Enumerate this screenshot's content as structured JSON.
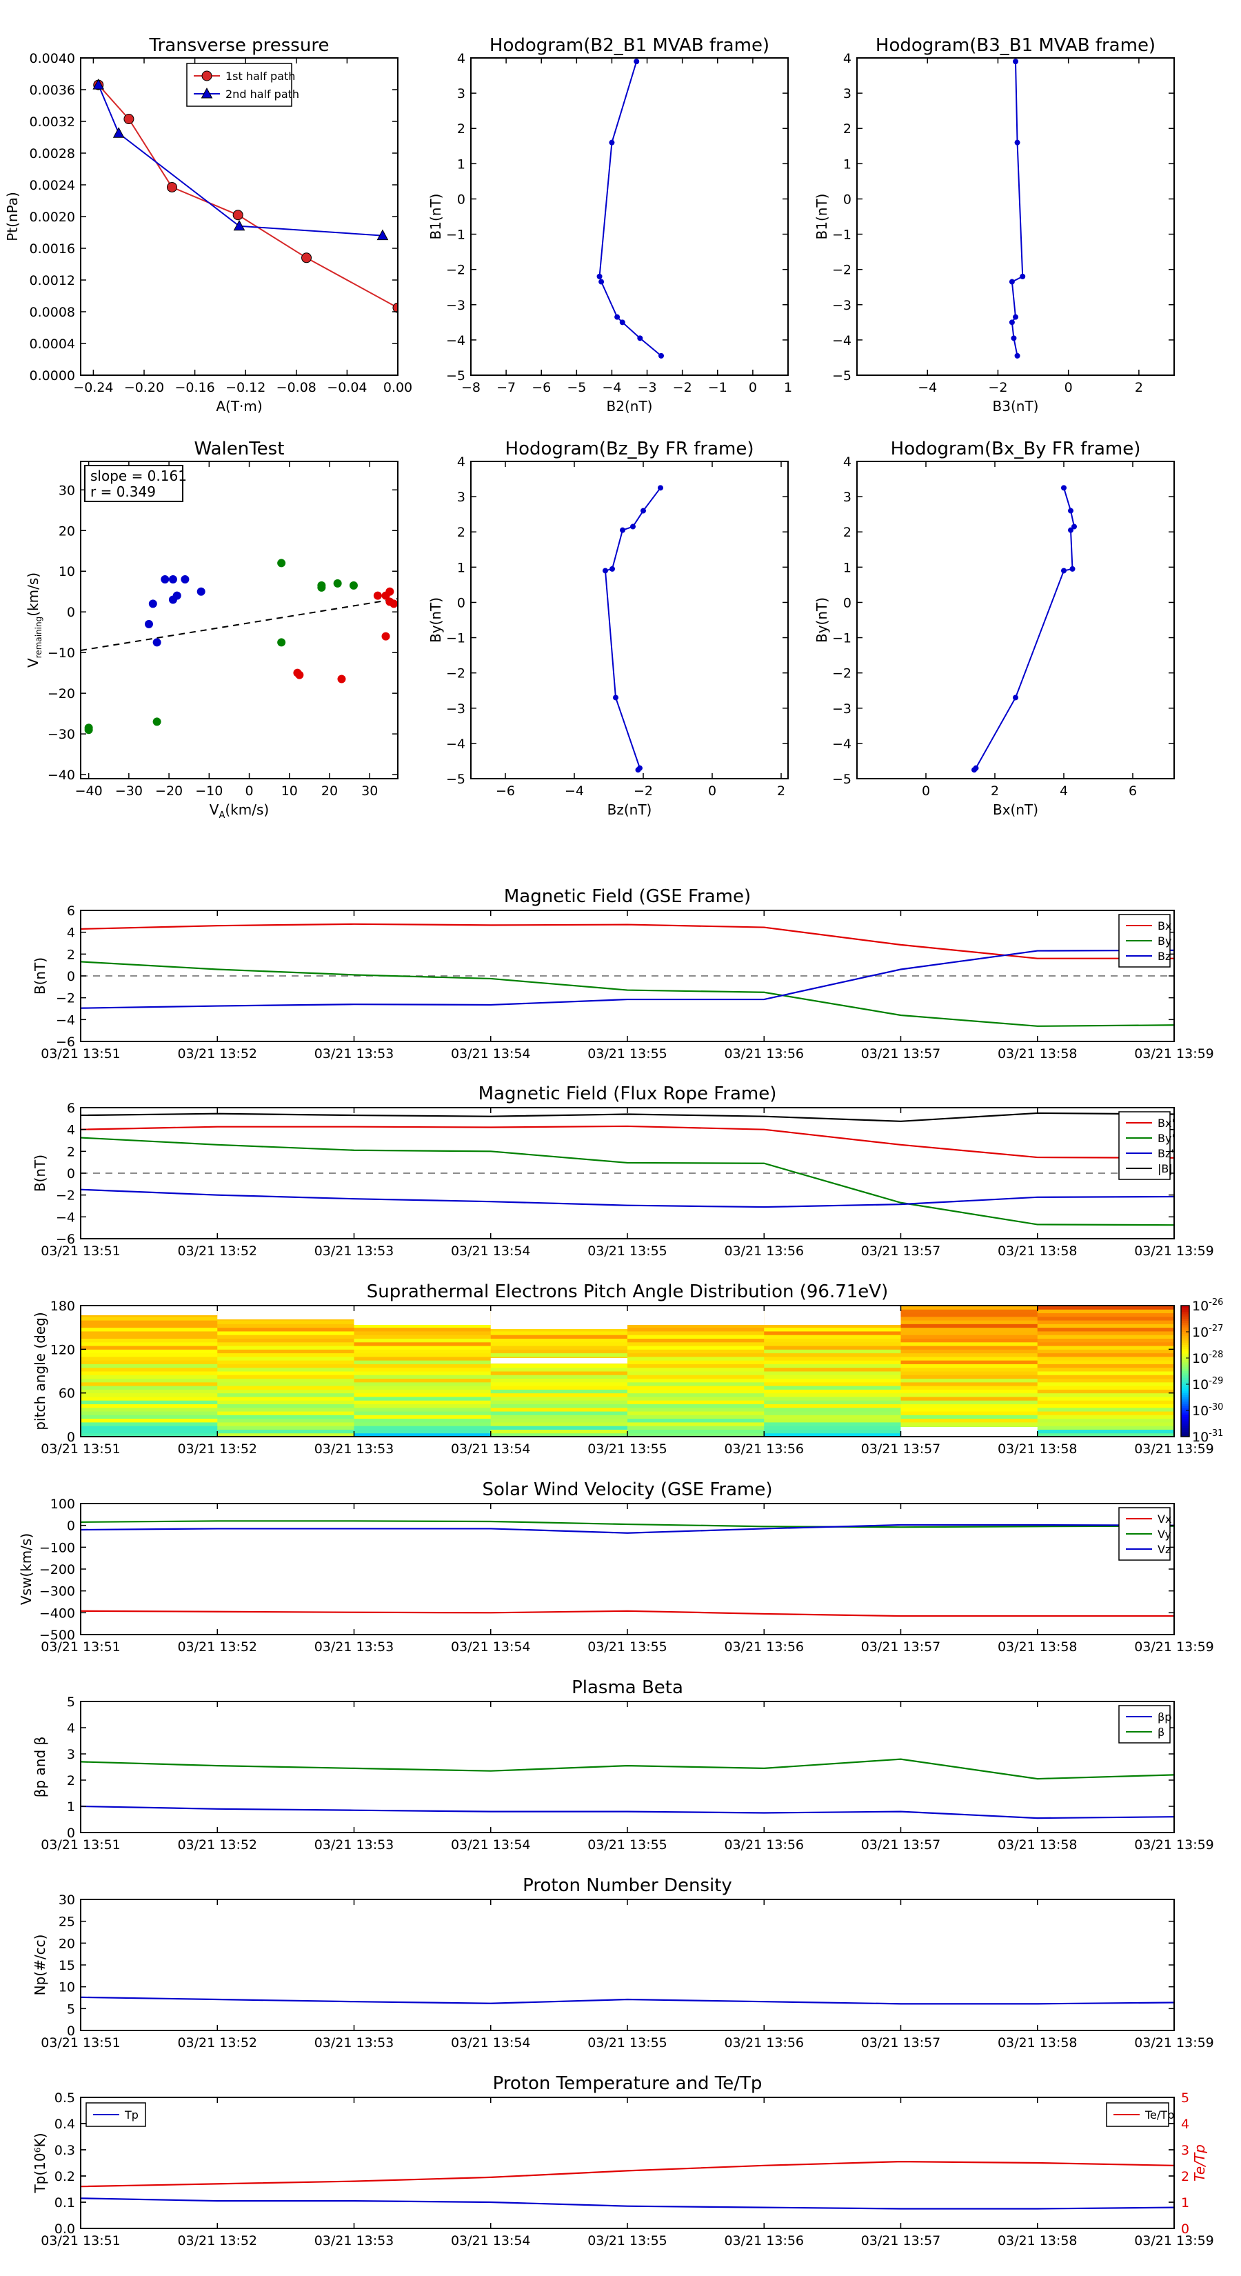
{
  "chart_data": [
    {
      "id": "p1",
      "type": "line",
      "title": "Transverse pressure",
      "xlabel": "A(T·m)",
      "ylabel": "Pt(nPa)",
      "xlim": [
        -0.25,
        0.0
      ],
      "ylim": [
        0.0,
        0.004
      ],
      "xticks": [
        -0.24,
        -0.2,
        -0.16,
        -0.12,
        -0.08,
        -0.04,
        0.0
      ],
      "xticklabels": [
        "−0.24",
        "−0.20",
        "−0.16",
        "−0.12",
        "−0.08",
        "−0.04",
        "0.00"
      ],
      "yticks": [
        0.0,
        0.0004,
        0.0008,
        0.0012,
        0.0016,
        0.002,
        0.0024,
        0.0028,
        0.0032,
        0.0036,
        0.004
      ],
      "yticklabels": [
        "0.0000",
        "0.0004",
        "0.0008",
        "0.0012",
        "0.0016",
        "0.0020",
        "0.0024",
        "0.0028",
        "0.0032",
        "0.0036",
        "0.0040"
      ],
      "legend": "top-center",
      "series": [
        {
          "name": "1st half path",
          "color": "#d62728",
          "marker": "circle",
          "x": [
            -0.236,
            -0.212,
            -0.178,
            -0.126,
            -0.072,
            0.0
          ],
          "y": [
            0.00366,
            0.00323,
            0.00237,
            0.00202,
            0.00148,
            0.00085
          ]
        },
        {
          "name": "2nd half path",
          "color": "#0000cc",
          "marker": "triangle",
          "x": [
            -0.236,
            -0.22,
            -0.125,
            -0.012
          ],
          "y": [
            0.00366,
            0.00305,
            0.00188,
            0.00176
          ]
        }
      ]
    },
    {
      "id": "p2",
      "type": "line",
      "title": "Hodogram(B2_B1 MVAB frame)",
      "xlabel": "B2(nT)",
      "ylabel": "B1(nT)",
      "xlim": [
        -8,
        1
      ],
      "ylim": [
        -5,
        4
      ],
      "xticks": [
        -8,
        -7,
        -6,
        -5,
        -4,
        -3,
        -2,
        -1,
        0,
        1
      ],
      "xticklabels": [
        "−8",
        "−7",
        "−6",
        "−5",
        "−4",
        "−3",
        "−2",
        "−1",
        "0",
        "1"
      ],
      "yticks": [
        -5,
        -4,
        -3,
        -2,
        -1,
        0,
        1,
        2,
        3,
        4
      ],
      "yticklabels": [
        "−5",
        "−4",
        "−3",
        "−2",
        "−1",
        "0",
        "1",
        "2",
        "3",
        "4"
      ],
      "series": [
        {
          "name": "",
          "color": "#0000cc",
          "marker": "dot",
          "x": [
            -3.3,
            -4.0,
            -4.35,
            -4.3,
            -3.85,
            -3.7,
            -3.2,
            -2.6
          ],
          "y": [
            3.9,
            1.6,
            -2.2,
            -2.35,
            -3.35,
            -3.5,
            -3.95,
            -4.45
          ]
        }
      ]
    },
    {
      "id": "p3",
      "type": "line",
      "title": "Hodogram(B3_B1 MVAB frame)",
      "xlabel": "B3(nT)",
      "ylabel": "B1(nT)",
      "xlim": [
        -6,
        3
      ],
      "ylim": [
        -5,
        4
      ],
      "xticks": [
        -4,
        -2,
        0,
        2
      ],
      "xticklabels": [
        "−4",
        "−2",
        "0",
        "2"
      ],
      "yticks": [
        -5,
        -4,
        -3,
        -2,
        -1,
        0,
        1,
        2,
        3,
        4
      ],
      "yticklabels": [
        "−5",
        "−4",
        "−3",
        "−2",
        "−1",
        "0",
        "1",
        "2",
        "3",
        "4"
      ],
      "series": [
        {
          "name": "",
          "color": "#0000cc",
          "marker": "dot",
          "x": [
            -1.5,
            -1.45,
            -1.3,
            -1.6,
            -1.5,
            -1.6,
            -1.55,
            -1.45
          ],
          "y": [
            3.9,
            1.6,
            -2.2,
            -2.35,
            -3.35,
            -3.5,
            -3.95,
            -4.45
          ]
        }
      ]
    },
    {
      "id": "p4",
      "type": "scatter",
      "title": "WalenTest",
      "xlabel": "V",
      "xlabel_sub": "A",
      "xlabel_unit": "(km/s)",
      "ylabel": "V",
      "ylabel_sub": "remaining",
      "ylabel_unit": "(km/s)",
      "xlim": [
        -42,
        37
      ],
      "ylim": [
        -41,
        37
      ],
      "xticks": [
        -40,
        -30,
        -20,
        -10,
        0,
        10,
        20,
        30
      ],
      "xticklabels": [
        "−40",
        "−30",
        "−20",
        "−10",
        "0",
        "10",
        "20",
        "30"
      ],
      "yticks": [
        -40,
        -30,
        -20,
        -10,
        0,
        10,
        20,
        30
      ],
      "yticklabels": [
        "−40",
        "−30",
        "−20",
        "−10",
        "0",
        "10",
        "20",
        "30"
      ],
      "annotation_slope": "slope = 0.161",
      "annotation_r": "r = 0.349",
      "fit": {
        "slope": 0.161,
        "intercept": -2.7
      },
      "series": [
        {
          "name": "",
          "color": "#0000cc",
          "x": [
            -25,
            -24,
            -23,
            -21,
            -19,
            -18,
            -19,
            -16,
            -12
          ],
          "y": [
            -3,
            2,
            -7.5,
            8,
            3,
            4,
            8,
            8,
            5
          ]
        },
        {
          "name": "",
          "color": "#008000",
          "x": [
            -40,
            -40,
            -23,
            8,
            8,
            18,
            18,
            22,
            26
          ],
          "y": [
            -28.5,
            -29,
            -27,
            12,
            -7.5,
            6,
            6.5,
            7,
            6.5
          ]
        },
        {
          "name": "",
          "color": "#e00000",
          "x": [
            12,
            12.5,
            23,
            32,
            34,
            35,
            35,
            36,
            34
          ],
          "y": [
            -15,
            -15.5,
            -16.5,
            4,
            4,
            5,
            2.5,
            2,
            -6
          ]
        }
      ]
    },
    {
      "id": "p5",
      "type": "line",
      "title": "Hodogram(Bz_By FR frame)",
      "xlabel": "Bz(nT)",
      "ylabel": "By(nT)",
      "xlim": [
        -7,
        2.2
      ],
      "ylim": [
        -5,
        4
      ],
      "xticks": [
        -6,
        -4,
        -2,
        0,
        2
      ],
      "xticklabels": [
        "−6",
        "−4",
        "−2",
        "0",
        "2"
      ],
      "yticks": [
        -5,
        -4,
        -3,
        -2,
        -1,
        0,
        1,
        2,
        3,
        4
      ],
      "yticklabels": [
        "−5",
        "−4",
        "−3",
        "−2",
        "−1",
        "0",
        "1",
        "2",
        "3",
        "4"
      ],
      "series": [
        {
          "name": "",
          "color": "#0000cc",
          "marker": "dot",
          "x": [
            -1.5,
            -2.0,
            -2.3,
            -2.6,
            -2.9,
            -3.1,
            -2.8,
            -2.1,
            -2.15
          ],
          "y": [
            3.25,
            2.6,
            2.15,
            2.05,
            0.95,
            0.9,
            -2.7,
            -4.7,
            -4.75
          ]
        }
      ]
    },
    {
      "id": "p6",
      "type": "line",
      "title": "Hodogram(Bx_By FR frame)",
      "xlabel": "Bx(nT)",
      "ylabel": "By(nT)",
      "xlim": [
        -2,
        7.2
      ],
      "ylim": [
        -5,
        4
      ],
      "xticks": [
        0,
        2,
        4,
        6
      ],
      "xticklabels": [
        "0",
        "2",
        "4",
        "6"
      ],
      "yticks": [
        -5,
        -4,
        -3,
        -2,
        -1,
        0,
        1,
        2,
        3,
        4
      ],
      "yticklabels": [
        "−5",
        "−4",
        "−3",
        "−2",
        "−1",
        "0",
        "1",
        "2",
        "3",
        "4"
      ],
      "series": [
        {
          "name": "",
          "color": "#0000cc",
          "marker": "dot",
          "x": [
            4.0,
            4.2,
            4.3,
            4.2,
            4.25,
            4.0,
            2.6,
            1.45,
            1.4
          ],
          "y": [
            3.25,
            2.6,
            2.15,
            2.05,
            0.95,
            0.9,
            -2.7,
            -4.7,
            -4.75
          ]
        }
      ]
    },
    {
      "id": "t1",
      "type": "line",
      "title": "Magnetic Field (GSE Frame)",
      "ylabel": "B(nT)",
      "ylim": [
        -6,
        6
      ],
      "yticks": [
        -6,
        -4,
        -2,
        0,
        2,
        4,
        6
      ],
      "yticklabels": [
        "−6",
        "−4",
        "−2",
        "0",
        "2",
        "4",
        "6"
      ],
      "zero_line": true,
      "legend": "top-right",
      "series": [
        {
          "name": "Bx",
          "color": "#e00000",
          "y": [
            4.3,
            4.6,
            4.75,
            4.65,
            4.7,
            4.45,
            2.85,
            1.6,
            1.6
          ]
        },
        {
          "name": "By",
          "color": "#008000",
          "y": [
            1.3,
            0.6,
            0.1,
            -0.25,
            -1.3,
            -1.5,
            -3.6,
            -4.6,
            -4.5
          ]
        },
        {
          "name": "Bz",
          "color": "#0000cc",
          "y": [
            -2.95,
            -2.75,
            -2.6,
            -2.65,
            -2.15,
            -2.15,
            0.6,
            2.3,
            2.35
          ]
        }
      ]
    },
    {
      "id": "t2",
      "type": "line",
      "title": "Magnetic Field (Flux Rope Frame)",
      "ylabel": "B(nT)",
      "ylim": [
        -6,
        6
      ],
      "yticks": [
        -6,
        -4,
        -2,
        0,
        2,
        4,
        6
      ],
      "yticklabels": [
        "−6",
        "−4",
        "−2",
        "0",
        "2",
        "4",
        "6"
      ],
      "zero_line": true,
      "legend": "top-right",
      "series": [
        {
          "name": "Bx'",
          "color": "#e00000",
          "y": [
            4.0,
            4.25,
            4.25,
            4.2,
            4.3,
            4.0,
            2.6,
            1.45,
            1.4
          ]
        },
        {
          "name": "By'",
          "color": "#008000",
          "y": [
            3.25,
            2.6,
            2.1,
            2.0,
            0.95,
            0.9,
            -2.7,
            -4.7,
            -4.75
          ]
        },
        {
          "name": "Bz'",
          "color": "#0000cc",
          "y": [
            -1.5,
            -2.0,
            -2.35,
            -2.6,
            -2.95,
            -3.1,
            -2.85,
            -2.2,
            -2.15
          ]
        },
        {
          "name": "|B|",
          "color": "#000000",
          "y": [
            5.3,
            5.45,
            5.3,
            5.2,
            5.4,
            5.2,
            4.75,
            5.5,
            5.4
          ]
        }
      ]
    },
    {
      "id": "t3",
      "type": "heatmap",
      "title": "Suprathermal Electrons Pitch Angle Distribution (96.71eV)",
      "ylabel": "pitch angle (deg)",
      "ylim": [
        0,
        180
      ],
      "yticks": [
        0,
        60,
        120,
        180
      ],
      "yticklabels": [
        "0",
        "60",
        "120",
        "180"
      ],
      "colorbar_ticks": [
        "10",
        "10",
        "10",
        "10",
        "10",
        "10"
      ],
      "colorbar_exponents": [
        "-26",
        "-27",
        "-28",
        "-29",
        "-30",
        "-31"
      ]
    },
    {
      "id": "t4",
      "type": "line",
      "title": "Solar Wind Velocity (GSE Frame)",
      "ylabel": "Vsw(km/s)",
      "ylim": [
        -500,
        100
      ],
      "yticks": [
        -500,
        -400,
        -300,
        -200,
        -100,
        0,
        100
      ],
      "yticklabels": [
        "−500",
        "−400",
        "−300",
        "−200",
        "−100",
        "0",
        "100"
      ],
      "legend": "top-right",
      "series": [
        {
          "name": "Vx",
          "color": "#e00000",
          "y": [
            -392,
            -395,
            -398,
            -400,
            -392,
            -405,
            -415,
            -415,
            -415
          ]
        },
        {
          "name": "Vy",
          "color": "#008000",
          "y": [
            15,
            20,
            20,
            18,
            5,
            -5,
            -8,
            -5,
            -3
          ]
        },
        {
          "name": "Vz",
          "color": "#0000cc",
          "y": [
            -20,
            -15,
            -15,
            -15,
            -35,
            -15,
            2,
            2,
            0
          ]
        }
      ]
    },
    {
      "id": "t5",
      "type": "line",
      "title": "Plasma Beta",
      "ylabel": "βp and β",
      "ylim": [
        0,
        5
      ],
      "yticks": [
        0,
        1,
        2,
        3,
        4,
        5
      ],
      "yticklabels": [
        "0",
        "1",
        "2",
        "3",
        "4",
        "5"
      ],
      "legend": "top-right",
      "series": [
        {
          "name": "βp",
          "color": "#0000cc",
          "y": [
            1.0,
            0.9,
            0.85,
            0.8,
            0.8,
            0.75,
            0.8,
            0.55,
            0.6
          ]
        },
        {
          "name": "β",
          "color": "#008000",
          "y": [
            2.7,
            2.55,
            2.45,
            2.35,
            2.55,
            2.45,
            2.8,
            2.05,
            2.2
          ]
        }
      ]
    },
    {
      "id": "t6",
      "type": "line",
      "title": "Proton Number Density",
      "ylabel": "Np(#/cc)",
      "ylim": [
        0,
        30
      ],
      "yticks": [
        0,
        5,
        10,
        15,
        20,
        25,
        30
      ],
      "yticklabels": [
        "0",
        "5",
        "10",
        "15",
        "20",
        "25",
        "30"
      ],
      "series": [
        {
          "name": "",
          "color": "#0000cc",
          "y": [
            7.6,
            7.1,
            6.6,
            6.2,
            7.1,
            6.6,
            6.1,
            6.1,
            6.4
          ]
        }
      ]
    },
    {
      "id": "t7",
      "type": "line",
      "title": "Proton Temperature and Te/Tp",
      "ylabel": "Tp(10⁶K)",
      "ylabel_right": "Te/Tp",
      "ylim": [
        0,
        0.5
      ],
      "ylim_right": [
        0,
        5
      ],
      "yticks": [
        0,
        0.1,
        0.2,
        0.3,
        0.4,
        0.5
      ],
      "yticklabels": [
        "0.0",
        "0.1",
        "0.2",
        "0.3",
        "0.4",
        "0.5"
      ],
      "yticks_right": [
        0,
        1,
        2,
        3,
        4,
        5
      ],
      "yticklabels_right": [
        "0",
        "1",
        "2",
        "3",
        "4",
        "5"
      ],
      "legend": "top-left / top-right",
      "series": [
        {
          "name": "Tp",
          "color": "#0000cc",
          "axis": "left",
          "y": [
            0.115,
            0.105,
            0.105,
            0.1,
            0.085,
            0.08,
            0.075,
            0.075,
            0.08
          ]
        },
        {
          "name": "Te/Tp",
          "color": "#e00000",
          "axis": "right",
          "y": [
            1.6,
            1.7,
            1.8,
            1.95,
            2.2,
            2.4,
            2.55,
            2.5,
            2.4
          ]
        }
      ]
    }
  ],
  "time_axis": {
    "ticks": [
      "03/21 13:51",
      "03/21 13:52",
      "03/21 13:53",
      "03/21 13:54",
      "03/21 13:55",
      "03/21 13:56",
      "03/21 13:57",
      "03/21 13:58",
      "03/21 13:59"
    ]
  }
}
